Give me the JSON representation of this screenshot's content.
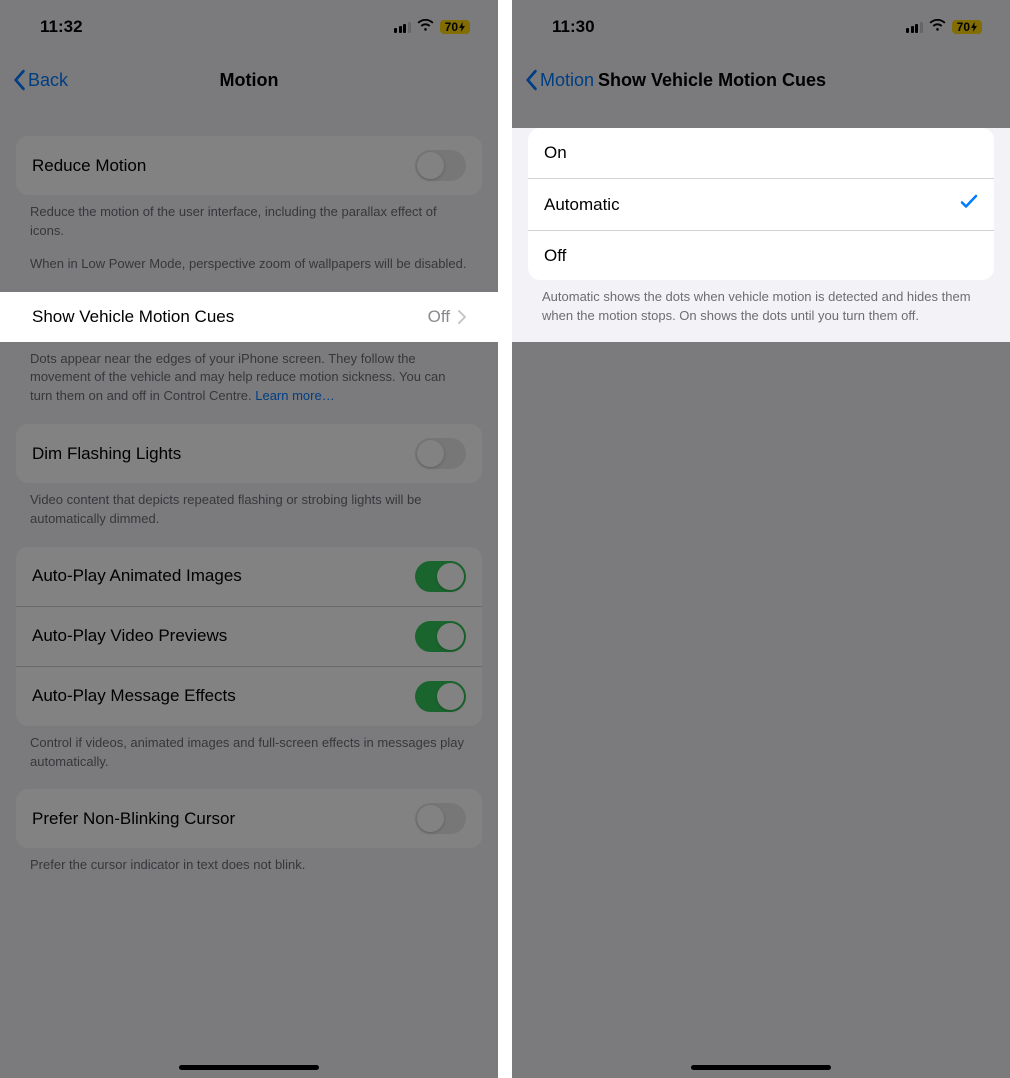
{
  "left": {
    "status": {
      "time": "11:32",
      "battery": "70"
    },
    "nav": {
      "back": "Back",
      "title": "Motion"
    },
    "reduce_motion": {
      "label": "Reduce Motion",
      "on": false
    },
    "reduce_motion_footer": "Reduce the motion of the user interface, including the parallax effect of icons.",
    "reduce_motion_footer2": "When in Low Power Mode, perspective zoom of wallpapers will be disabled.",
    "vehicle_cues": {
      "label": "Show Vehicle Motion Cues",
      "value": "Off"
    },
    "vehicle_cues_footer": "Dots appear near the edges of your iPhone screen. They follow the movement of the vehicle and may help reduce motion sickness. You can turn them on and off in Control Centre. ",
    "vehicle_cues_link": "Learn more…",
    "dim_flashing": {
      "label": "Dim Flashing Lights",
      "on": false
    },
    "dim_flashing_footer": "Video content that depicts repeated flashing or strobing lights will be automatically dimmed.",
    "autoplay": {
      "animated": {
        "label": "Auto-Play Animated Images",
        "on": true
      },
      "previews": {
        "label": "Auto-Play Video Previews",
        "on": true
      },
      "effects": {
        "label": "Auto-Play Message Effects",
        "on": true
      }
    },
    "autoplay_footer": "Control if videos, animated images and full-screen effects in messages play automatically.",
    "cursor": {
      "label": "Prefer Non-Blinking Cursor",
      "on": false
    },
    "cursor_footer": "Prefer the cursor indicator in text does not blink."
  },
  "right": {
    "status": {
      "time": "11:30",
      "battery": "70"
    },
    "nav": {
      "back": "Motion",
      "title": "Show Vehicle Motion Cues"
    },
    "options": {
      "on": "On",
      "automatic": "Automatic",
      "off": "Off",
      "selected": "automatic"
    },
    "footer": "Automatic shows the dots when vehicle motion is detected and hides them when the motion stops. On shows the dots until you turn them off."
  }
}
